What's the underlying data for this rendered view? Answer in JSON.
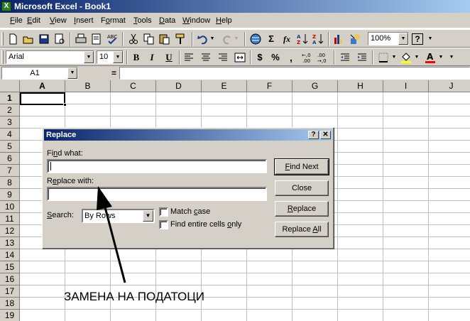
{
  "window": {
    "title": "Microsoft Excel - Book1",
    "app_icon": "X"
  },
  "menu": [
    {
      "pre": "",
      "u": "F",
      "post": "ile"
    },
    {
      "pre": "",
      "u": "E",
      "post": "dit"
    },
    {
      "pre": "",
      "u": "V",
      "post": "iew"
    },
    {
      "pre": "",
      "u": "I",
      "post": "nsert"
    },
    {
      "pre": "F",
      "u": "o",
      "post": "rmat"
    },
    {
      "pre": "",
      "u": "T",
      "post": "ools"
    },
    {
      "pre": "",
      "u": "D",
      "post": "ata"
    },
    {
      "pre": "",
      "u": "W",
      "post": "indow"
    },
    {
      "pre": "",
      "u": "H",
      "post": "elp"
    }
  ],
  "toolbar": {
    "zoom": "100%",
    "font_name": "Arial",
    "font_size": "10",
    "bold": "B",
    "italic": "I",
    "underline": "U",
    "currency": "$",
    "percent": "%",
    "comma": ",",
    "sum": "Σ",
    "fx": "fx",
    "help": "?"
  },
  "formula_bar": {
    "cell_ref": "A1",
    "equals": "=",
    "value": ""
  },
  "sheet": {
    "columns": [
      "A",
      "B",
      "C",
      "D",
      "E",
      "F",
      "G",
      "H",
      "I",
      "J"
    ],
    "rows": [
      "1",
      "2",
      "3",
      "4",
      "5",
      "6",
      "7",
      "8",
      "9",
      "10",
      "11",
      "12",
      "13",
      "14",
      "15",
      "16",
      "17",
      "18",
      "19"
    ],
    "active_cell": "A1"
  },
  "dialog": {
    "title": "Replace",
    "help_btn": "?",
    "close_btn": "✕",
    "find_label_pre": "Fi",
    "find_label_u": "n",
    "find_label_post": "d what:",
    "find_value": "",
    "replace_label_pre": "R",
    "replace_label_u": "e",
    "replace_label_post": "place with:",
    "replace_value": "",
    "search_label_pre": "",
    "search_label_u": "S",
    "search_label_post": "earch:",
    "search_value": "By Rows",
    "match_case_pre": "Match ",
    "match_case_u": "c",
    "match_case_post": "ase",
    "match_case_checked": false,
    "entire_cells_pre": "Find entire cells ",
    "entire_cells_u": "o",
    "entire_cells_post": "nly",
    "entire_cells_checked": false,
    "find_next_pre": "",
    "find_next_u": "F",
    "find_next_post": "ind Next",
    "close_label": "Close",
    "replace_pre": "",
    "replace_u": "R",
    "replace_post": "eplace",
    "replace_all_pre": "Replace ",
    "replace_all_u": "A",
    "replace_all_post": "ll"
  },
  "annotation": {
    "text": "ЗАМЕНА НА ПОДАТОЦИ"
  }
}
